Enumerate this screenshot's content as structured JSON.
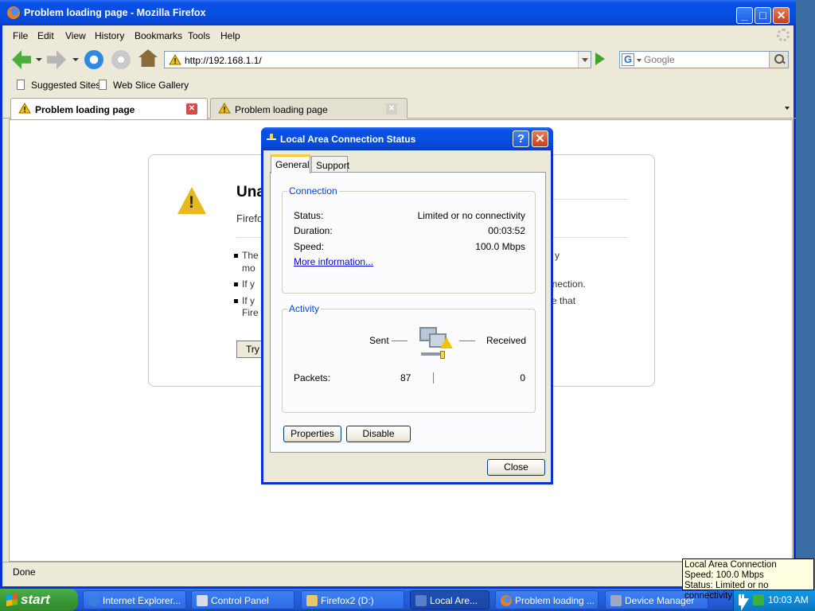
{
  "browser": {
    "window_title": "Problem loading page - Mozilla Firefox",
    "menu": [
      "File",
      "Edit",
      "View",
      "History",
      "Bookmarks",
      "Tools",
      "Help"
    ],
    "url": "http://192.168.1.1/",
    "search_placeholder": "Google",
    "bookmarks": [
      "Suggested Sites",
      "Web Slice Gallery"
    ],
    "tabs": [
      {
        "label": "Problem loading page",
        "active": true
      },
      {
        "label": "Problem loading page",
        "active": false
      }
    ],
    "status": "Done",
    "error_page": {
      "title_fragment": "Una",
      "subtitle_fragment": "Firefo",
      "bullet1_start": "The",
      "bullet1_line2": "mo",
      "bullet1_end": "y",
      "bullet2_start": "If y",
      "bullet2_end": "nnection.",
      "bullet3_start": "If y",
      "bullet3_end": "e that",
      "bullet3_line2": "Fire",
      "try_again": "Try A",
      "title_tail": "."
    }
  },
  "dialog": {
    "title": "Local Area Connection Status",
    "tabs": [
      "General",
      "Support"
    ],
    "connection": {
      "legend": "Connection",
      "status_label": "Status:",
      "status_value": "Limited or no connectivity",
      "duration_label": "Duration:",
      "duration_value": "00:03:52",
      "speed_label": "Speed:",
      "speed_value": "100.0 Mbps",
      "more_info": "More information..."
    },
    "activity": {
      "legend": "Activity",
      "sent_label": "Sent",
      "received_label": "Received",
      "packets_label": "Packets:",
      "packets_sent": "87",
      "packets_received": "0"
    },
    "buttons": {
      "properties": "Properties",
      "disable": "Disable",
      "close": "Close"
    }
  },
  "taskbar": {
    "start": "start",
    "tasks": [
      "Internet Explorer...",
      "Control Panel",
      "Firefox2 (D:)",
      "Local Are...",
      "Problem loading ...",
      "Device Manager"
    ],
    "clock": "10:03 AM"
  },
  "tooltip": {
    "line1": "Local Area Connection",
    "line2": "Speed: 100.0 Mbps",
    "line3": "Status: Limited or no connectivity"
  },
  "colors": {
    "xp_blue": "#0a4ee6",
    "start_green": "#3a9a37",
    "tooltip_bg": "#ffffe1",
    "group_legend": "#0046d5"
  }
}
